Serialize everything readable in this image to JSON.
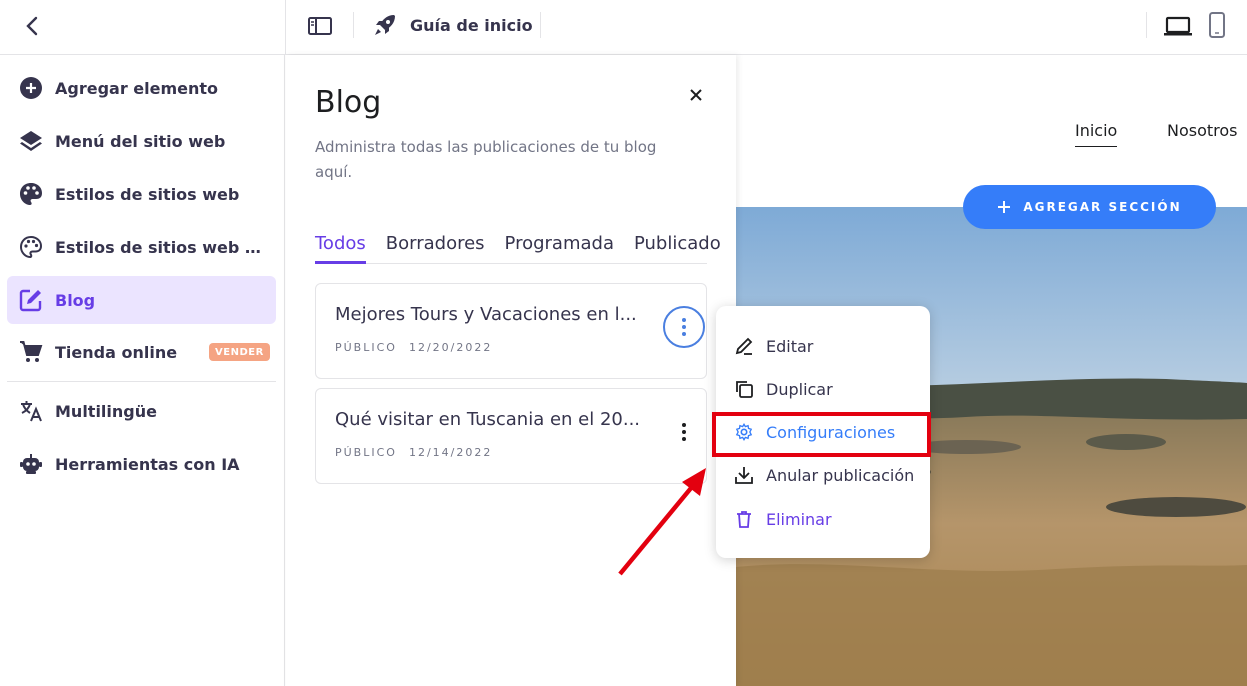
{
  "topbar": {
    "guide_label": "Guía de inicio"
  },
  "sidebar": {
    "items": [
      {
        "label": "Agregar elemento",
        "icon": "plus-circle-icon"
      },
      {
        "label": "Menú del sitio web",
        "icon": "layers-icon"
      },
      {
        "label": "Estilos de sitios web",
        "icon": "palette-icon"
      },
      {
        "label": "Estilos de sitios web de di...",
        "icon": "palette-outline-icon"
      },
      {
        "label": "Blog",
        "icon": "edit-icon",
        "active": true
      },
      {
        "label": "Tienda online",
        "icon": "cart-icon",
        "badge": "VENDER"
      },
      {
        "label": "Multilingüe",
        "icon": "translate-icon"
      },
      {
        "label": "Herramientas con IA",
        "icon": "robot-icon"
      }
    ]
  },
  "panel": {
    "title": "Blog",
    "description": "Administra todas las publicaciones de tu blog aquí.",
    "tabs": [
      "Todos",
      "Borradores",
      "Programada",
      "Publicado"
    ],
    "active_tab": "Todos",
    "posts": [
      {
        "title": "Mejores Tours y Vacaciones en l...",
        "status": "PÚBLICO",
        "date": "12/20/2022"
      },
      {
        "title": "Qué visitar en Tuscania en el 20...",
        "status": "PÚBLICO",
        "date": "12/14/2022"
      }
    ]
  },
  "menu": {
    "items": [
      {
        "label": "Editar",
        "icon": "pencil-icon"
      },
      {
        "label": "Duplicar",
        "icon": "copy-icon"
      },
      {
        "label": "Configuraciones",
        "icon": "gear-icon"
      },
      {
        "label": "Anular publicación",
        "icon": "download-icon"
      },
      {
        "label": "Eliminar",
        "icon": "trash-icon"
      }
    ]
  },
  "preview": {
    "nav": [
      "Inicio",
      "Nosotros"
    ],
    "add_section_label": "AGREGAR SECCIÓN"
  },
  "colors": {
    "accent": "#673de6",
    "active_bg": "#ebe4ff",
    "badge": "#f5a483",
    "add_section": "#357df9",
    "highlight_border": "#e3000f"
  }
}
